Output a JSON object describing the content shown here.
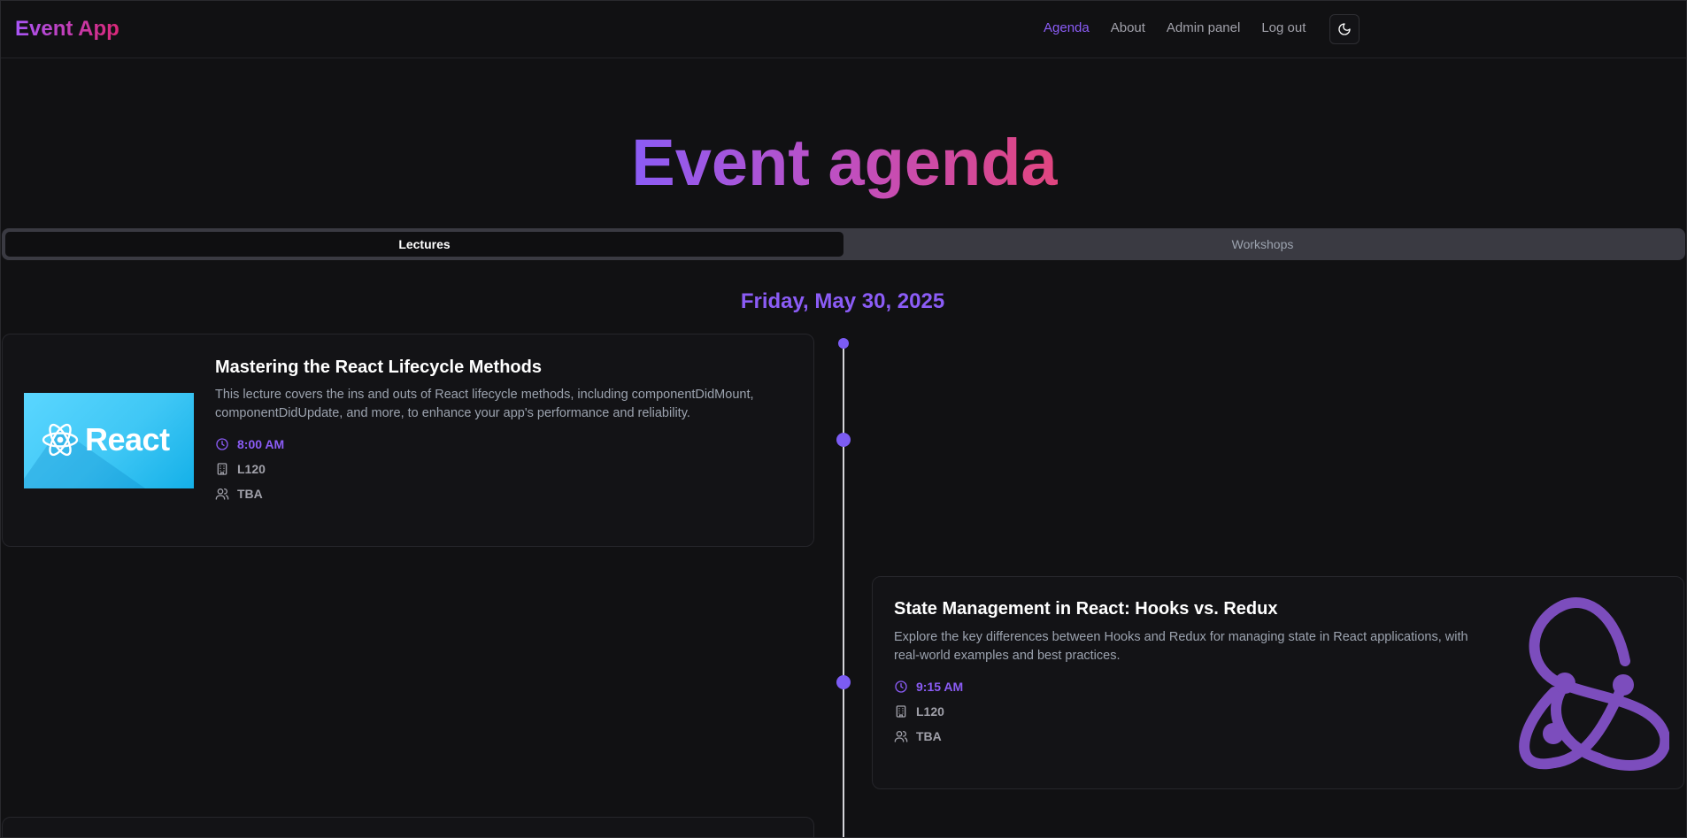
{
  "header": {
    "brand": "Event App",
    "nav": [
      {
        "label": "Agenda",
        "active": true
      },
      {
        "label": "About",
        "active": false
      },
      {
        "label": "Admin panel",
        "active": false
      },
      {
        "label": "Log out",
        "active": false
      }
    ],
    "theme_toggle_icon": "moon-icon"
  },
  "hero": {
    "title": "Event agenda"
  },
  "tabs": [
    {
      "label": "Lectures",
      "active": true
    },
    {
      "label": "Workshops",
      "active": false
    }
  ],
  "agenda": {
    "date": "Friday, May 30, 2025",
    "events": [
      {
        "title": "Mastering the React Lifecycle Methods",
        "description": "This lecture covers the ins and outs of React lifecycle methods, including componentDidMount, componentDidUpdate, and more, to enhance your app's performance and reliability.",
        "time": "8:00 AM",
        "room": "L120",
        "speaker": "TBA",
        "image_label": "React",
        "image_icon": "react-logo-icon"
      },
      {
        "title": "State Management in React: Hooks vs. Redux",
        "description": "Explore the key differences between Hooks and Redux for managing state in React applications, with real-world examples and best practices.",
        "time": "9:15 AM",
        "room": "L120",
        "speaker": "TBA",
        "image_icon": "redux-logo-icon"
      }
    ]
  },
  "colors": {
    "accent": "#8b5cf6",
    "brand_gradient_start": "#a855f7",
    "brand_gradient_end": "#db2777",
    "background": "#111113",
    "card": "#131316"
  }
}
